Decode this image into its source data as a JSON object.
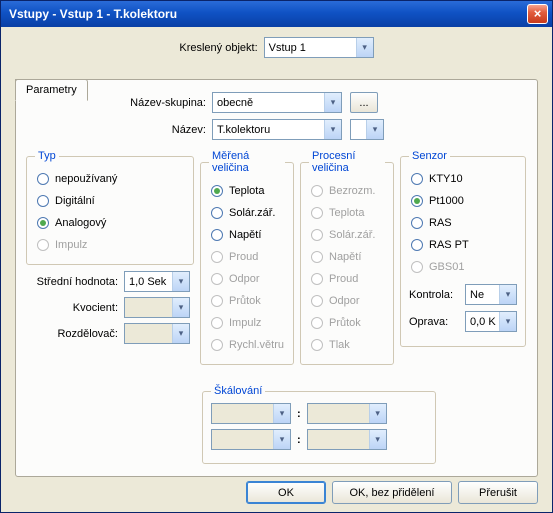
{
  "title": "Vstupy  - Vstup 1 - T.kolektoru",
  "header": {
    "kresleny_label": "Kreslený objekt:",
    "kresleny_value": "Vstup 1"
  },
  "tab": {
    "label": "Parametry"
  },
  "names": {
    "group_label": "Název-skupina:",
    "group_value": "obecně",
    "name_label": "Název:",
    "name_value": "T.kolektoru",
    "ellipsis": "..."
  },
  "typ": {
    "legend": "Typ",
    "items": [
      {
        "label": "nepoužívaný",
        "selected": false,
        "disabled": false
      },
      {
        "label": "Digitální",
        "selected": false,
        "disabled": false
      },
      {
        "label": "Analogový",
        "selected": true,
        "disabled": false
      },
      {
        "label": "Impulz",
        "selected": false,
        "disabled": true
      }
    ],
    "mean_label": "Střední hodnota:",
    "mean_value": "1,0 Sek",
    "kvocient_label": "Kvocient:",
    "rozdel_label": "Rozdělovač:"
  },
  "merena": {
    "legend": "Měřená veličina",
    "items": [
      {
        "label": "Teplota",
        "selected": true,
        "disabled": false
      },
      {
        "label": "Solár.zář.",
        "selected": false,
        "disabled": false
      },
      {
        "label": "Napětí",
        "selected": false,
        "disabled": false
      },
      {
        "label": "Proud",
        "selected": false,
        "disabled": true
      },
      {
        "label": "Odpor",
        "selected": false,
        "disabled": true
      },
      {
        "label": "Průtok",
        "selected": false,
        "disabled": true
      },
      {
        "label": "Impulz",
        "selected": false,
        "disabled": true
      },
      {
        "label": "Rychl.větru",
        "selected": false,
        "disabled": true
      }
    ]
  },
  "procesni": {
    "legend": "Procesní veličina",
    "items": [
      {
        "label": "Bezrozm.",
        "selected": false,
        "disabled": true
      },
      {
        "label": "Teplota",
        "selected": false,
        "disabled": true
      },
      {
        "label": "Solár.zář.",
        "selected": false,
        "disabled": true
      },
      {
        "label": "Napětí",
        "selected": false,
        "disabled": true
      },
      {
        "label": "Proud",
        "selected": false,
        "disabled": true
      },
      {
        "label": "Odpor",
        "selected": false,
        "disabled": true
      },
      {
        "label": "Průtok",
        "selected": false,
        "disabled": true
      },
      {
        "label": "Tlak",
        "selected": false,
        "disabled": true
      }
    ]
  },
  "senzor": {
    "legend": "Senzor",
    "items": [
      {
        "label": "KTY10",
        "selected": false,
        "disabled": false
      },
      {
        "label": "Pt1000",
        "selected": true,
        "disabled": false
      },
      {
        "label": "RAS",
        "selected": false,
        "disabled": false
      },
      {
        "label": "RAS PT",
        "selected": false,
        "disabled": false
      },
      {
        "label": "GBS01",
        "selected": false,
        "disabled": true
      }
    ],
    "kontrola_label": "Kontrola:",
    "kontrola_value": "Ne",
    "oprava_label": "Oprava:",
    "oprava_value": "0,0 K"
  },
  "scaling": {
    "legend": "Škálování"
  },
  "buttons": {
    "ok": "OK",
    "ok_unassigned": "OK, bez přidělení",
    "cancel": "Přerušit"
  }
}
